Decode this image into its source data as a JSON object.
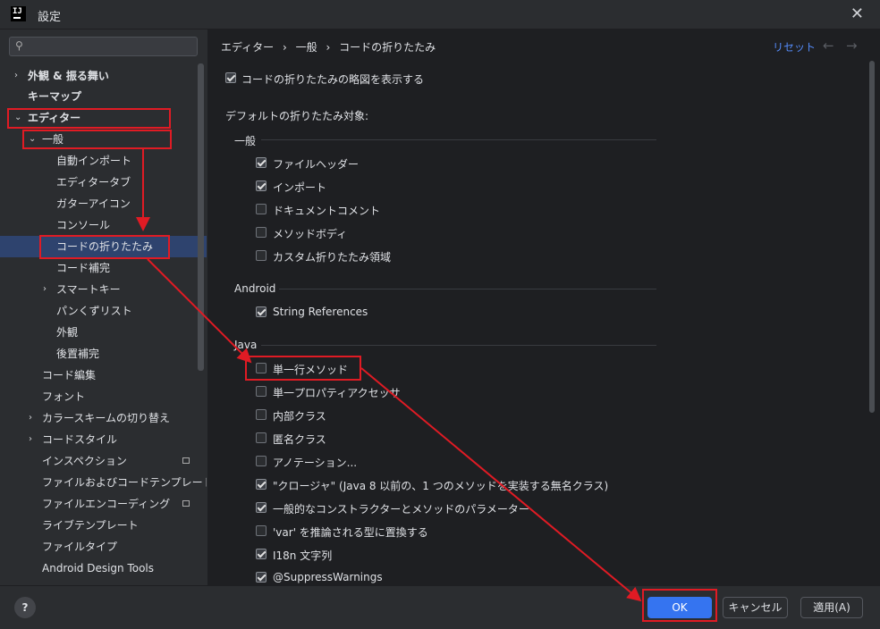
{
  "window": {
    "title": "設定",
    "app_logo": "IJ"
  },
  "sidebar": {
    "search_placeholder": "",
    "items": [
      {
        "label": "外観 & 振る舞い"
      },
      {
        "label": "キーマップ"
      },
      {
        "label": "エディター"
      },
      {
        "label": "一般"
      },
      {
        "label": "自動インポート"
      },
      {
        "label": "エディタータブ"
      },
      {
        "label": "ガターアイコン"
      },
      {
        "label": "コンソール"
      },
      {
        "label": "コードの折りたたみ"
      },
      {
        "label": "コード補完"
      },
      {
        "label": "スマートキー"
      },
      {
        "label": "パンくずリスト"
      },
      {
        "label": "外観"
      },
      {
        "label": "後置補完"
      },
      {
        "label": "コード編集"
      },
      {
        "label": "フォント"
      },
      {
        "label": "カラースキームの切り替え"
      },
      {
        "label": "コードスタイル"
      },
      {
        "label": "インスペクション"
      },
      {
        "label": "ファイルおよびコードテンプレート"
      },
      {
        "label": "ファイルエンコーディング"
      },
      {
        "label": "ライブテンプレート"
      },
      {
        "label": "ファイルタイプ"
      },
      {
        "label": "Android Design Tools"
      }
    ]
  },
  "main": {
    "breadcrumb": [
      "エディター",
      "一般",
      "コードの折りたたみ"
    ],
    "breadcrumb_sep": "›",
    "reset_label": "リセット",
    "show_outline": {
      "label": "コードの折りたたみの略図を表示する",
      "checked": true
    },
    "defaults_title": "デフォルトの折りたたみ対象:",
    "general": {
      "title": "一般",
      "options": [
        {
          "label": "ファイルヘッダー",
          "checked": true
        },
        {
          "label": "インポート",
          "checked": true
        },
        {
          "label": "ドキュメントコメント",
          "checked": false
        },
        {
          "label": "メソッドボディ",
          "checked": false
        },
        {
          "label": "カスタム折りたたみ領域",
          "checked": false
        }
      ]
    },
    "android": {
      "title": "Android",
      "options": [
        {
          "label": "String References",
          "checked": true
        }
      ]
    },
    "java": {
      "title": "Java",
      "options": [
        {
          "label": "単一行メソッド",
          "checked": false
        },
        {
          "label": "単一プロパティアクセッサ",
          "checked": false
        },
        {
          "label": "内部クラス",
          "checked": false
        },
        {
          "label": "匿名クラス",
          "checked": false
        },
        {
          "label": "アノテーション...",
          "checked": false
        },
        {
          "label": "\"クロージャ\" (Java 8 以前の、1 つのメソッドを実装する無名クラス)",
          "checked": true
        },
        {
          "label": "一般的なコンストラクターとメソッドのパラメーター",
          "checked": true
        },
        {
          "label": "'var' を推論される型に置換する",
          "checked": false
        },
        {
          "label": "I18n 文字列",
          "checked": true
        },
        {
          "label": "@SuppressWarnings",
          "checked": true
        }
      ]
    }
  },
  "footer": {
    "help_label": "?",
    "ok_label": "OK",
    "cancel_label": "キャンセル",
    "apply_label": "適用(A)"
  },
  "colors": {
    "background": "#2b2d30",
    "content_background": "#1e1f22",
    "selection": "#2e436e",
    "accent": "#3574f0",
    "link": "#548af7",
    "annotation": "#e01b24"
  },
  "icons": [
    "search-icon",
    "close-icon",
    "chevron-right-icon",
    "chevron-down-icon",
    "back-arrow-icon",
    "forward-arrow-icon",
    "help-icon",
    "settings-badge-icon"
  ]
}
